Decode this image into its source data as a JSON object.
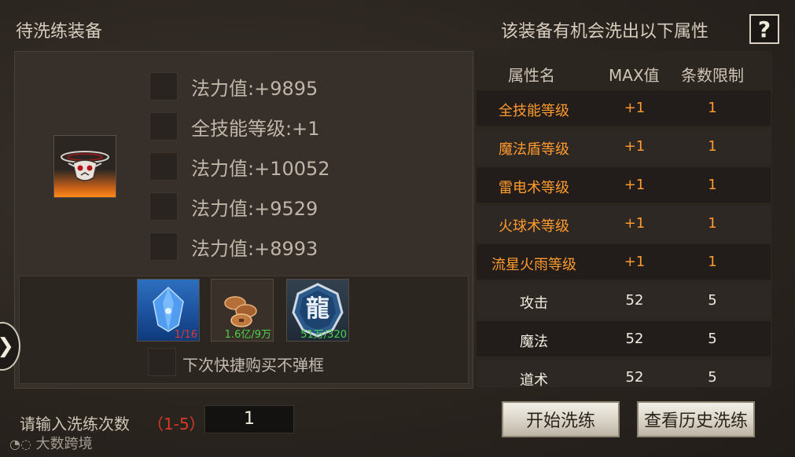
{
  "header": {
    "left_title": "待洗练装备",
    "right_title": "该装备有机会洗出以下属性",
    "help_label": "?"
  },
  "equipment": {
    "icon": "demon-mask-ring-icon",
    "attributes": [
      {
        "text": "法力值:+9895"
      },
      {
        "text": "全技能等级:+1"
      },
      {
        "text": "法力值:+10052"
      },
      {
        "text": "法力值:+9529"
      },
      {
        "text": "法力值:+8993"
      }
    ]
  },
  "materials": [
    {
      "icon": "blue-crystal-icon",
      "count": "1/16",
      "count_color": "#e23a2a"
    },
    {
      "icon": "copper-coins-icon",
      "count": "1.6亿/9万",
      "count_color": "#4ad24a"
    },
    {
      "icon": "dragon-token-icon",
      "icon_text": "龍",
      "count": "51万/320",
      "count_color": "#4ad24a"
    }
  ],
  "no_popup_label": "下次快捷购买不弹框",
  "table": {
    "headers": {
      "name": "属性名",
      "max": "MAX值",
      "limit": "条数限制"
    },
    "rows": [
      {
        "name": "全技能等级",
        "max": "+1",
        "limit": "1",
        "highlight": true
      },
      {
        "name": "魔法盾等级",
        "max": "+1",
        "limit": "1",
        "highlight": true
      },
      {
        "name": "雷电术等级",
        "max": "+1",
        "limit": "1",
        "highlight": true
      },
      {
        "name": "火球术等级",
        "max": "+1",
        "limit": "1",
        "highlight": true
      },
      {
        "name": "流星火雨等级",
        "max": "+1",
        "limit": "1",
        "highlight": true
      },
      {
        "name": "攻击",
        "max": "52",
        "limit": "5",
        "highlight": false
      },
      {
        "name": "魔法",
        "max": "52",
        "limit": "5",
        "highlight": false
      },
      {
        "name": "道术",
        "max": "52",
        "limit": "5",
        "highlight": false
      }
    ]
  },
  "controls": {
    "count_label": "请输入洗练次数",
    "count_range": "（1-5）",
    "count_value": "1",
    "start_button": "开始洗练",
    "history_button": "查看历史洗练"
  },
  "colors": {
    "highlight": "#ff9a2e",
    "normal": "#f2ece0"
  },
  "watermark": "大数跨境"
}
